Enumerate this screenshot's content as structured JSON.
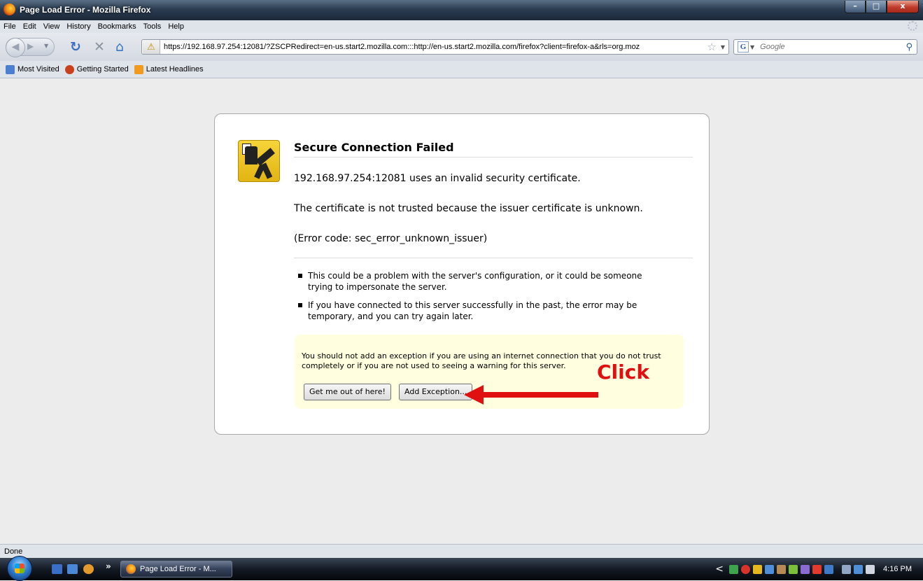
{
  "window": {
    "title": "Page Load Error - Mozilla Firefox",
    "controls": {
      "minimize": "–",
      "maximize": "□",
      "close": "x"
    }
  },
  "menubar": [
    "File",
    "Edit",
    "View",
    "History",
    "Bookmarks",
    "Tools",
    "Help"
  ],
  "navbar": {
    "url": "https://192.168.97.254:12081/?ZSCPRedirect=en-us.start2.mozilla.com:::http://en-us.start2.mozilla.com/firefox?client=firefox-a&rls=org.moz",
    "search_placeholder": "Google"
  },
  "bookmarks": [
    "Most Visited",
    "Getting Started",
    "Latest Headlines"
  ],
  "error_page": {
    "title": "Secure Connection Failed",
    "line1": "192.168.97.254:12081 uses an invalid security certificate.",
    "line2": "The certificate is not trusted because the issuer certificate is unknown.",
    "line3": "(Error code: sec_error_unknown_issuer)",
    "bullets": [
      "This could be a problem with the server's configuration, or it could be someone trying to impersonate the server.",
      "If you have connected to this server successfully in the past, the error may be temporary, and you can try again later."
    ],
    "warning_text": "You should not add an exception if you are using an internet connection that you do not trust completely or if you are not used to seeing a warning for this server.",
    "get_out_label": "Get me out of here!",
    "add_exception_label": "Add Exception..."
  },
  "annotation": {
    "label": "Click",
    "color": "#e01010"
  },
  "statusbar": {
    "text": "Done"
  },
  "taskbar": {
    "quicklaunch_more": "»",
    "task_label": "Page Load Error - M...",
    "tray_chevron": "<",
    "clock": "4:16 PM"
  }
}
